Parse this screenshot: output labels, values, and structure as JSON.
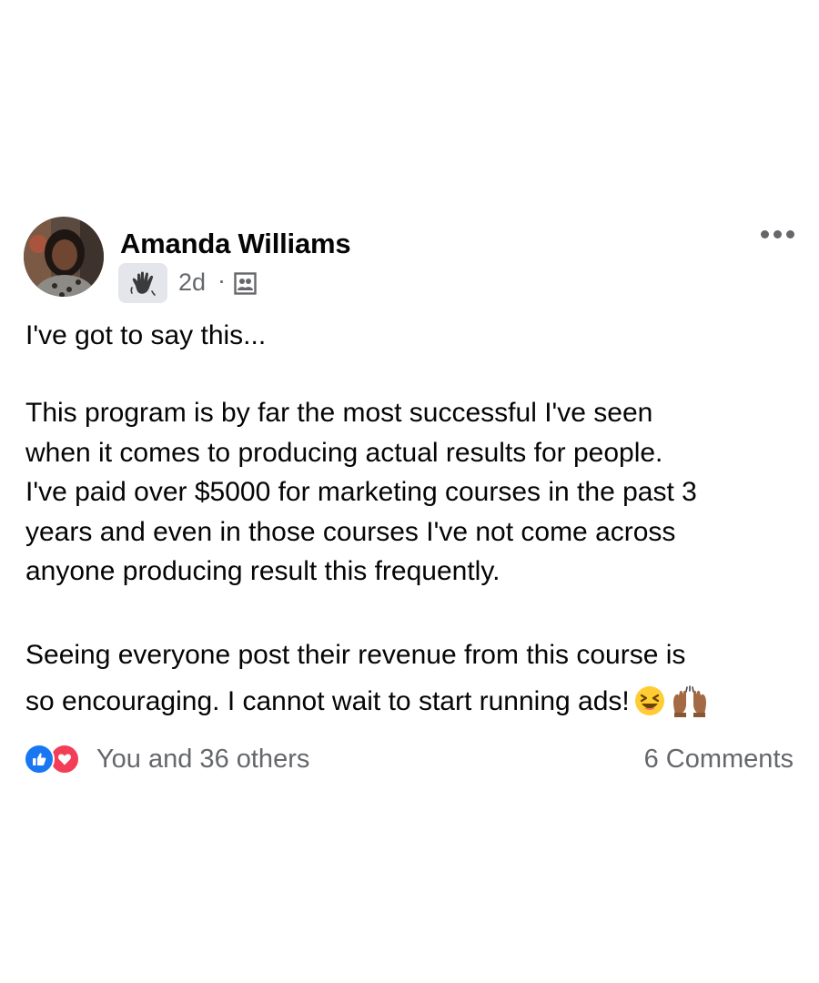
{
  "post": {
    "author": "Amanda Williams",
    "badge_icon": "waving-hand-icon",
    "time": "2d",
    "separator": "·",
    "audience_icon": "custom-audience-icon",
    "more_icon": "more-options-icon",
    "paragraphs": {
      "p1": [
        "I've got to say this..."
      ],
      "p2": [
        "This program is by far the most successful I've seen",
        "when it comes to producing actual results for people.",
        "I've paid over $5000 for marketing courses in the past 3",
        "years and even in those courses I've not come across",
        "anyone producing result this frequently."
      ],
      "p3": [
        "Seeing everyone post their revenue from this course is",
        "so encouraging. I cannot wait to start running ads!"
      ]
    },
    "emojis": [
      "laughing-face-icon",
      "raised-hands-icon"
    ]
  },
  "footer": {
    "reactions": [
      "like-icon",
      "love-icon"
    ],
    "reaction_text": "You and 36 others",
    "comments_text": "6 Comments"
  },
  "colors": {
    "text": "#050505",
    "secondary_text": "#65676b",
    "like_blue": "#1877f2",
    "love_red": "#f33e58",
    "badge_bg": "#e4e6eb"
  }
}
